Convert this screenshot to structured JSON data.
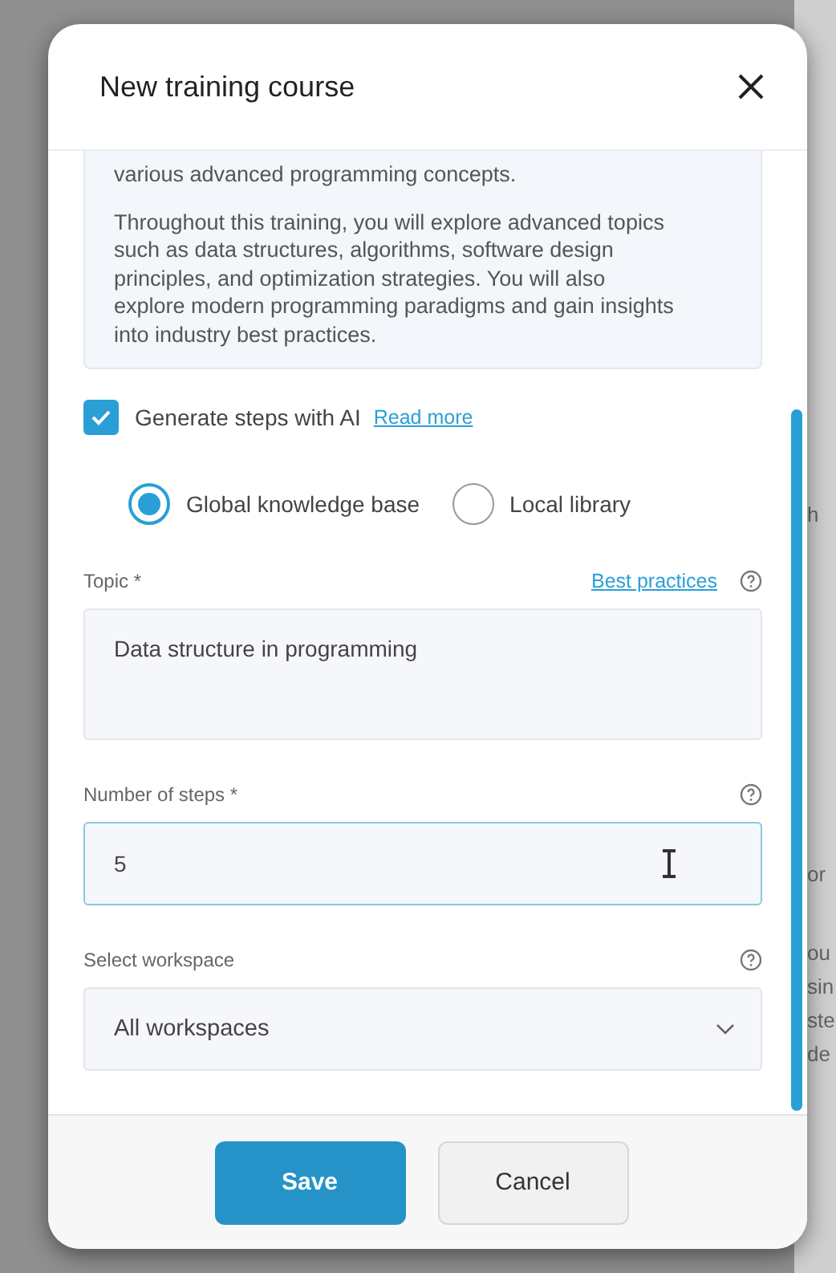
{
  "dialog": {
    "title": "New training course",
    "description": [
      "various advanced programming concepts.",
      "Throughout this training, you will explore advanced topics such as data structures, algorithms, software design principles, and optimization strategies. You will also explore modern programming paradigms and gain insights into industry best practices."
    ],
    "ai_option": {
      "label": "Generate steps with AI",
      "checked": true,
      "link": "Read more"
    },
    "sources": [
      {
        "label": "Global knowledge base",
        "selected": true
      },
      {
        "label": "Local library",
        "selected": false
      }
    ],
    "fields": [
      {
        "kind": "textarea",
        "label": "Topic *",
        "link": "Best practices",
        "value": "Data structure in programming",
        "focused": false
      },
      {
        "kind": "text",
        "label": "Number of steps *",
        "value": "5",
        "focused": true
      },
      {
        "kind": "select",
        "label": "Select workspace",
        "value": "All workspaces",
        "focused": false
      }
    ],
    "buttons": [
      {
        "label": "Save",
        "kind": "primary"
      },
      {
        "label": "Cancel",
        "kind": "secondary"
      }
    ]
  },
  "background_text": [
    "h",
    "or",
    "ou",
    "sin",
    "ste",
    "de"
  ]
}
